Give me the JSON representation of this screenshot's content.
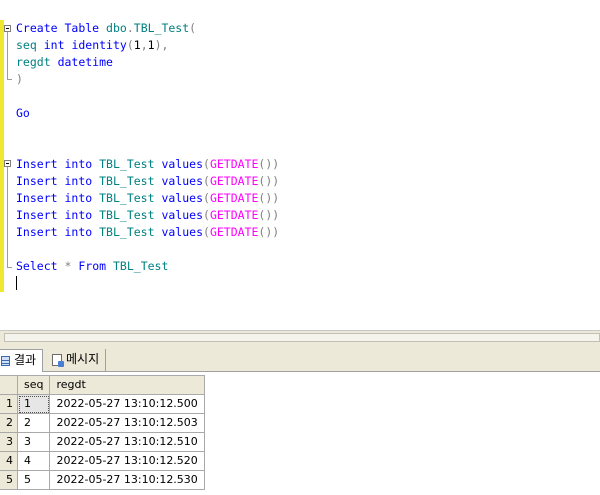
{
  "editor": {
    "lines": [
      [
        {
          "t": "Create",
          "c": "kw"
        },
        {
          "t": " ",
          "c": "txt"
        },
        {
          "t": "Table",
          "c": "kw"
        },
        {
          "t": " ",
          "c": "txt"
        },
        {
          "t": "dbo",
          "c": "id"
        },
        {
          "t": ".",
          "c": "op"
        },
        {
          "t": "TBL_Test",
          "c": "id"
        },
        {
          "t": "(",
          "c": "op"
        }
      ],
      [
        {
          "t": "seq",
          "c": "id"
        },
        {
          "t": " ",
          "c": "txt"
        },
        {
          "t": "int",
          "c": "kw"
        },
        {
          "t": " ",
          "c": "txt"
        },
        {
          "t": "identity",
          "c": "kw"
        },
        {
          "t": "(",
          "c": "op"
        },
        {
          "t": "1",
          "c": "txt"
        },
        {
          "t": ",",
          "c": "op"
        },
        {
          "t": "1",
          "c": "txt"
        },
        {
          "t": "),",
          "c": "op"
        }
      ],
      [
        {
          "t": "regdt",
          "c": "id"
        },
        {
          "t": " ",
          "c": "txt"
        },
        {
          "t": "datetime",
          "c": "kw"
        }
      ],
      [
        {
          "t": ")",
          "c": "op"
        }
      ],
      [],
      [
        {
          "t": "Go",
          "c": "kw"
        }
      ],
      [],
      [],
      [
        {
          "t": "Insert",
          "c": "kw"
        },
        {
          "t": " ",
          "c": "txt"
        },
        {
          "t": "into",
          "c": "kw"
        },
        {
          "t": " ",
          "c": "txt"
        },
        {
          "t": "TBL_Test",
          "c": "id"
        },
        {
          "t": " ",
          "c": "txt"
        },
        {
          "t": "values",
          "c": "kw"
        },
        {
          "t": "(",
          "c": "op"
        },
        {
          "t": "GETDATE",
          "c": "fn"
        },
        {
          "t": "())",
          "c": "op"
        }
      ],
      [
        {
          "t": "Insert",
          "c": "kw"
        },
        {
          "t": " ",
          "c": "txt"
        },
        {
          "t": "into",
          "c": "kw"
        },
        {
          "t": " ",
          "c": "txt"
        },
        {
          "t": "TBL_Test",
          "c": "id"
        },
        {
          "t": " ",
          "c": "txt"
        },
        {
          "t": "values",
          "c": "kw"
        },
        {
          "t": "(",
          "c": "op"
        },
        {
          "t": "GETDATE",
          "c": "fn"
        },
        {
          "t": "())",
          "c": "op"
        }
      ],
      [
        {
          "t": "Insert",
          "c": "kw"
        },
        {
          "t": " ",
          "c": "txt"
        },
        {
          "t": "into",
          "c": "kw"
        },
        {
          "t": " ",
          "c": "txt"
        },
        {
          "t": "TBL_Test",
          "c": "id"
        },
        {
          "t": " ",
          "c": "txt"
        },
        {
          "t": "values",
          "c": "kw"
        },
        {
          "t": "(",
          "c": "op"
        },
        {
          "t": "GETDATE",
          "c": "fn"
        },
        {
          "t": "())",
          "c": "op"
        }
      ],
      [
        {
          "t": "Insert",
          "c": "kw"
        },
        {
          "t": " ",
          "c": "txt"
        },
        {
          "t": "into",
          "c": "kw"
        },
        {
          "t": " ",
          "c": "txt"
        },
        {
          "t": "TBL_Test",
          "c": "id"
        },
        {
          "t": " ",
          "c": "txt"
        },
        {
          "t": "values",
          "c": "kw"
        },
        {
          "t": "(",
          "c": "op"
        },
        {
          "t": "GETDATE",
          "c": "fn"
        },
        {
          "t": "())",
          "c": "op"
        }
      ],
      [
        {
          "t": "Insert",
          "c": "kw"
        },
        {
          "t": " ",
          "c": "txt"
        },
        {
          "t": "into",
          "c": "kw"
        },
        {
          "t": " ",
          "c": "txt"
        },
        {
          "t": "TBL_Test",
          "c": "id"
        },
        {
          "t": " ",
          "c": "txt"
        },
        {
          "t": "values",
          "c": "kw"
        },
        {
          "t": "(",
          "c": "op"
        },
        {
          "t": "GETDATE",
          "c": "fn"
        },
        {
          "t": "())",
          "c": "op"
        }
      ],
      [],
      [
        {
          "t": "Select",
          "c": "kw"
        },
        {
          "t": " ",
          "c": "txt"
        },
        {
          "t": "*",
          "c": "op"
        },
        {
          "t": " ",
          "c": "txt"
        },
        {
          "t": "From",
          "c": "kw"
        },
        {
          "t": " ",
          "c": "txt"
        },
        {
          "t": "TBL_Test",
          "c": "id"
        }
      ],
      []
    ],
    "colors": {
      "kw": "#0000ff",
      "id": "#008080",
      "fn": "#ff00ff",
      "op": "#808080",
      "txt": "#000000",
      "change_bar": "#f0e830"
    }
  },
  "result_tabs": {
    "results_label": "결과",
    "messages_label": "메시지"
  },
  "results": {
    "columns": [
      "seq",
      "regdt"
    ],
    "rows": [
      {
        "rownum": "1",
        "seq": "1",
        "regdt": "2022-05-27 13:10:12.500"
      },
      {
        "rownum": "2",
        "seq": "2",
        "regdt": "2022-05-27 13:10:12.503"
      },
      {
        "rownum": "3",
        "seq": "3",
        "regdt": "2022-05-27 13:10:12.510"
      },
      {
        "rownum": "4",
        "seq": "4",
        "regdt": "2022-05-27 13:10:12.520"
      },
      {
        "rownum": "5",
        "seq": "5",
        "regdt": "2022-05-27 13:10:12.530"
      }
    ]
  }
}
